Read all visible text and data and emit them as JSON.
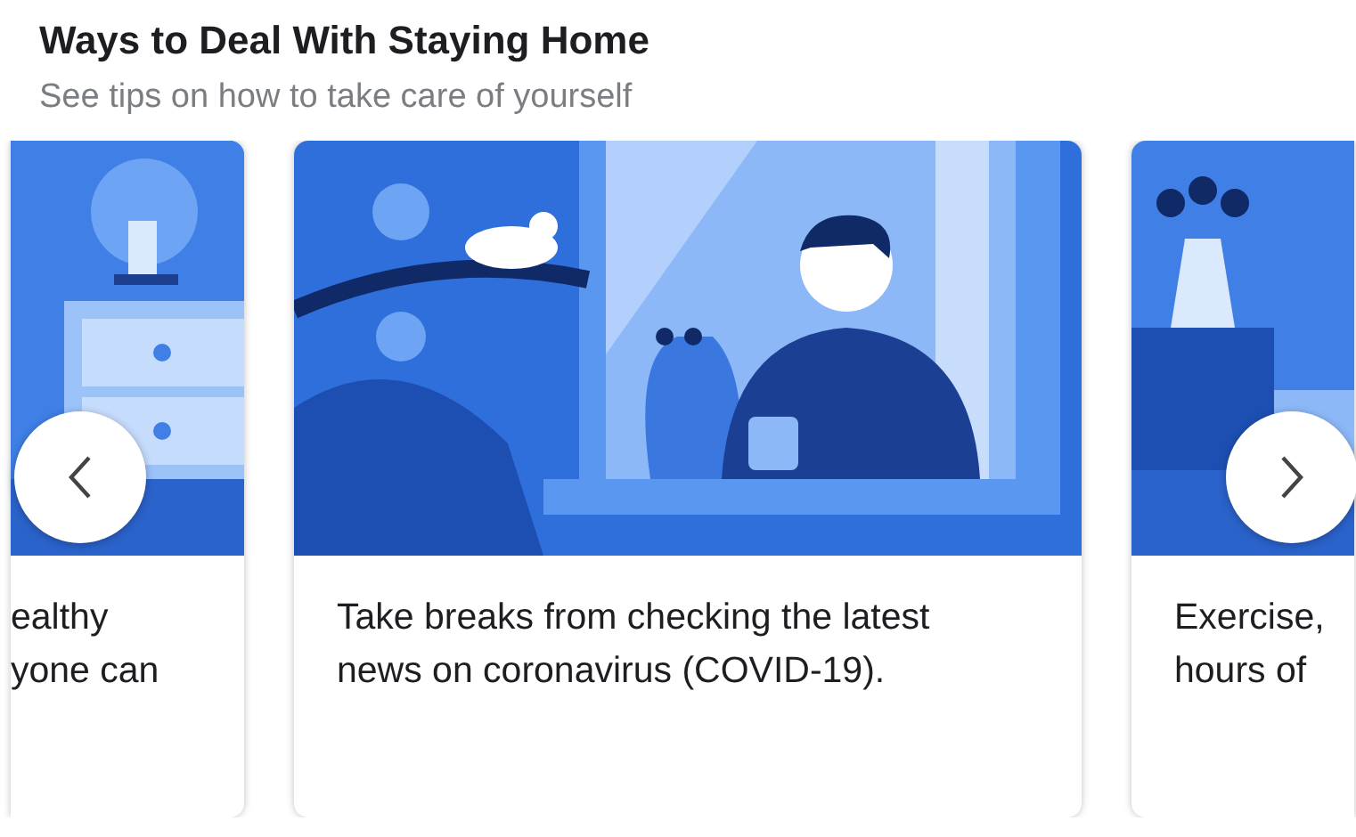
{
  "header": {
    "title": "Ways to Deal With Staying Home",
    "subtitle": "See tips on how to take care of yourself"
  },
  "cards": [
    {
      "kind": "bedroom",
      "text": "ealthy\nyone can"
    },
    {
      "kind": "window",
      "text": "Take breaks from checking the latest news on coronavirus (COVID-19)."
    },
    {
      "kind": "room",
      "text": "Exercise,\nhours of"
    }
  ],
  "nav": {
    "previous": true,
    "next": true
  }
}
